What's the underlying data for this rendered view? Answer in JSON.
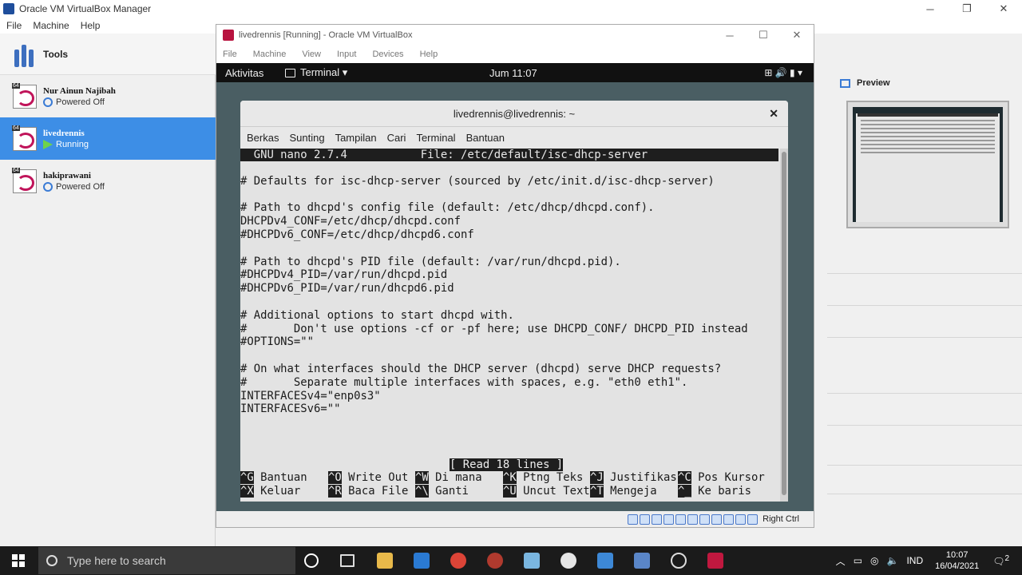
{
  "manager": {
    "title": "Oracle VM VirtualBox Manager",
    "menu": [
      "File",
      "Machine",
      "Help"
    ],
    "tools_label": "Tools",
    "vms": [
      {
        "name": "Nur Ainun Najibah",
        "state": "Powered Off",
        "badge": "64"
      },
      {
        "name": "livedrennis",
        "state": "Running",
        "badge": "64"
      },
      {
        "name": "hakiprawani",
        "state": "Powered Off",
        "badge": "64"
      }
    ],
    "preview_label": "Preview"
  },
  "vmwindow": {
    "title": "livedrennis [Running] - Oracle VM VirtualBox",
    "menu": [
      "File",
      "Machine",
      "View",
      "Input",
      "Devices",
      "Help"
    ],
    "host_key": "Right Ctrl"
  },
  "gnome": {
    "activities": "Aktivitas",
    "app": "Terminal ▾",
    "clock": "Jum 11:07",
    "tray": "⊞  🔊  ▮  ▾"
  },
  "terminal": {
    "title": "livedrennis@livedrennis: ~",
    "menu": [
      "Berkas",
      "Sunting",
      "Tampilan",
      "Cari",
      "Terminal",
      "Bantuan"
    ],
    "nano_header": "  GNU nano 2.7.4           File: /etc/default/isc-dhcp-server",
    "lines": [
      "",
      "# Defaults for isc-dhcp-server (sourced by /etc/init.d/isc-dhcp-server)",
      "",
      "# Path to dhcpd's config file (default: /etc/dhcp/dhcpd.conf).",
      "DHCPDv4_CONF=/etc/dhcp/dhcpd.conf",
      "#DHCPDv6_CONF=/etc/dhcp/dhcpd6.conf",
      "",
      "# Path to dhcpd's PID file (default: /var/run/dhcpd.pid).",
      "#DHCPDv4_PID=/var/run/dhcpd.pid",
      "#DHCPDv6_PID=/var/run/dhcpd6.pid",
      "",
      "# Additional options to start dhcpd with.",
      "#       Don't use options -cf or -pf here; use DHCPD_CONF/ DHCPD_PID instead",
      "#OPTIONS=\"\"",
      "",
      "# On what interfaces should the DHCP server (dhcpd) serve DHCP requests?",
      "#       Separate multiple interfaces with spaces, e.g. \"eth0 eth1\".",
      "INTERFACESv4=\"enp0s3\"",
      "INTERFACESv6=\"\""
    ],
    "status": "[ Read 18 lines ]",
    "shortcuts_row1": [
      {
        "key": "^G",
        "label": "Bantuan"
      },
      {
        "key": "^O",
        "label": "Write Out"
      },
      {
        "key": "^W",
        "label": "Di mana"
      },
      {
        "key": "^K",
        "label": "Ptng Teks"
      },
      {
        "key": "^J",
        "label": "Justifikas"
      },
      {
        "key": "^C",
        "label": "Pos Kursor"
      }
    ],
    "shortcuts_row2": [
      {
        "key": "^X",
        "label": "Keluar"
      },
      {
        "key": "^R",
        "label": "Baca File"
      },
      {
        "key": "^\\",
        "label": "Ganti"
      },
      {
        "key": "^U",
        "label": "Uncut Text"
      },
      {
        "key": "^T",
        "label": "Mengeja"
      },
      {
        "key": "^_",
        "label": "Ke baris"
      }
    ]
  },
  "taskbar": {
    "search_placeholder": "Type here to search",
    "lang": "IND",
    "time": "10:07",
    "date": "16/04/2021",
    "notifications": "2"
  }
}
